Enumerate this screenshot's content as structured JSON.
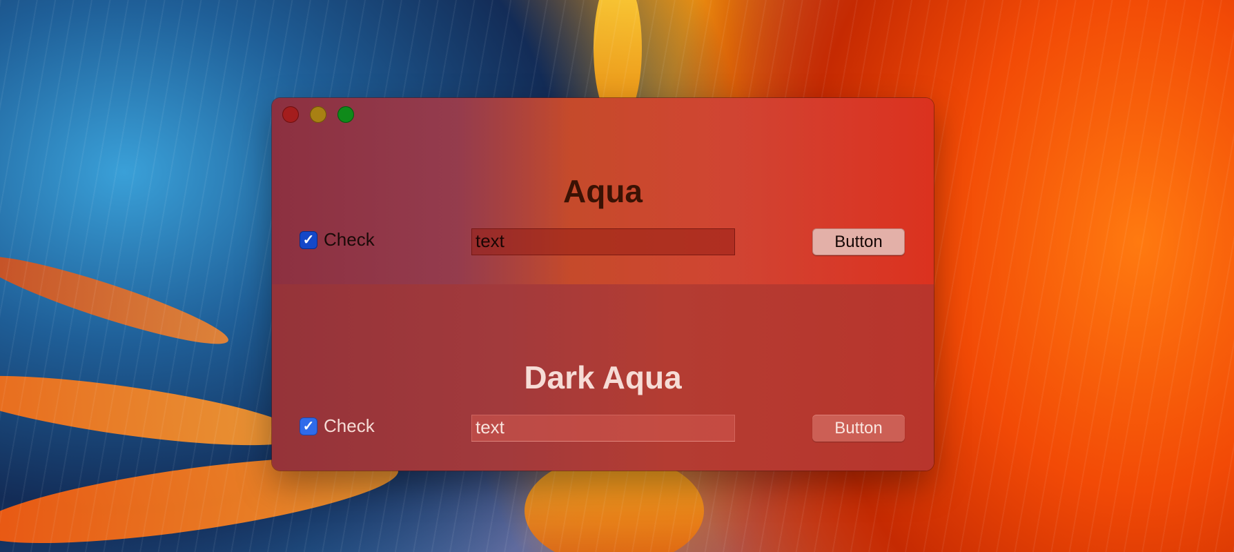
{
  "window": {
    "controls": {
      "close_icon": "close-circle",
      "minimize_icon": "minimize-circle",
      "maximize_icon": "maximize-circle",
      "close_color": "#a41d1d",
      "minimize_color": "#a88013",
      "maximize_color": "#0f8a1a"
    }
  },
  "aqua": {
    "title": "Aqua",
    "checkbox": {
      "label": "Check",
      "checked": true,
      "mark": "✓"
    },
    "text_field": {
      "value": "text"
    },
    "button": {
      "label": "Button"
    }
  },
  "dark_aqua": {
    "title": "Dark Aqua",
    "checkbox": {
      "label": "Check",
      "checked": true,
      "mark": "✓"
    },
    "text_field": {
      "value": "text"
    },
    "button": {
      "label": "Button"
    }
  },
  "colors": {
    "checkbox_accent": "#1548c8",
    "dark_checkbox_accent": "#2f6bea"
  }
}
